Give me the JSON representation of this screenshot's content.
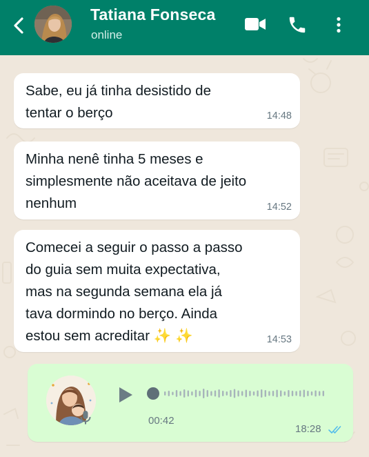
{
  "header": {
    "contact_name": "Tatiana Fonseca",
    "status": "online",
    "icons": [
      "back-arrow-icon",
      "video-call-icon",
      "phone-call-icon",
      "more-options-icon"
    ],
    "color": "#008069"
  },
  "messages": [
    {
      "lines": [
        "Sabe, eu já tinha desistido de",
        "tentar o berço"
      ],
      "time": "14:48"
    },
    {
      "lines": [
        "Minha nenê tinha 5 meses e",
        "simplesmente não aceitava de jeito",
        "nenhum"
      ],
      "time": "14:52"
    },
    {
      "lines": [
        "Comecei a seguir o passo a passo",
        "do guia sem muita expectativa,",
        "mas na segunda semana ela já",
        "tava dormindo no berço. Ainda",
        "estou sem acreditar ✨ ✨"
      ],
      "time": "14:53"
    }
  ],
  "voice_message": {
    "duration": "00:42",
    "time": "18:28",
    "read_status": "read",
    "tick_color": "#53bdeb",
    "progress": 0.0
  },
  "theme": {
    "chat_background": "#efe7dc",
    "incoming_bubble": "#ffffff",
    "outgoing_bubble": "#d9fdd3"
  }
}
